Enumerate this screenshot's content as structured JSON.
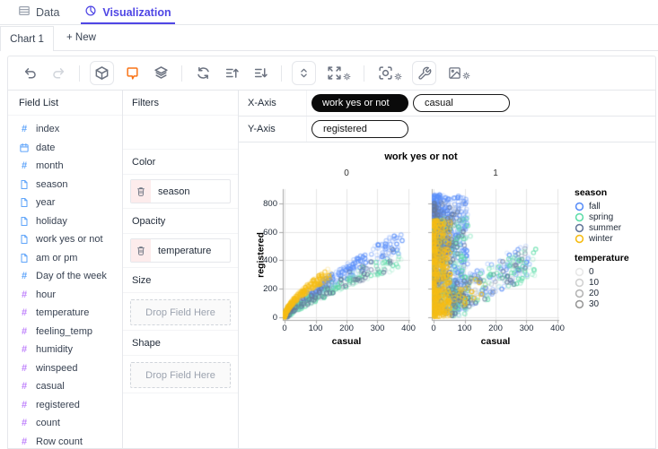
{
  "tabs": {
    "data": {
      "label": "Data"
    },
    "visualization": {
      "label": "Visualization"
    }
  },
  "chart_tabs": {
    "active": "Chart 1",
    "new_label": "+ New"
  },
  "toolbar": {
    "items": [
      {
        "icon": "undo"
      },
      {
        "icon": "redo",
        "disabled": true
      },
      {
        "divider": true
      },
      {
        "icon": "cube",
        "boxed": true
      },
      {
        "icon": "annotation",
        "accent": true
      },
      {
        "icon": "layers"
      },
      {
        "divider": true
      },
      {
        "icon": "refresh"
      },
      {
        "icon": "sort-ascending"
      },
      {
        "icon": "sort-descending"
      },
      {
        "divider": true
      },
      {
        "icon": "updown",
        "boxed": true
      },
      {
        "icon": "resize",
        "gear": true
      },
      {
        "divider": true
      },
      {
        "icon": "scan",
        "gear": true
      },
      {
        "icon": "wrench",
        "boxed": true
      },
      {
        "icon": "export-image",
        "gear": true
      }
    ]
  },
  "field_list": {
    "title": "Field List",
    "fields": [
      {
        "name": "index",
        "icon": "hash",
        "kind": "dimension"
      },
      {
        "name": "date",
        "icon": "calendar",
        "kind": "dimension"
      },
      {
        "name": "month",
        "icon": "hash",
        "kind": "dimension"
      },
      {
        "name": "season",
        "icon": "text",
        "kind": "dimension"
      },
      {
        "name": "year",
        "icon": "text",
        "kind": "dimension"
      },
      {
        "name": "holiday",
        "icon": "text",
        "kind": "dimension"
      },
      {
        "name": "work yes or not",
        "icon": "text",
        "kind": "dimension"
      },
      {
        "name": "am or pm",
        "icon": "text",
        "kind": "dimension"
      },
      {
        "name": "Day of the week",
        "icon": "hash",
        "kind": "dimension"
      },
      {
        "name": "hour",
        "icon": "hash",
        "kind": "measure"
      },
      {
        "name": "temperature",
        "icon": "hash",
        "kind": "measure"
      },
      {
        "name": "feeling_temp",
        "icon": "hash",
        "kind": "measure"
      },
      {
        "name": "humidity",
        "icon": "hash",
        "kind": "measure"
      },
      {
        "name": "winspeed",
        "icon": "hash",
        "kind": "measure"
      },
      {
        "name": "casual",
        "icon": "hash",
        "kind": "measure"
      },
      {
        "name": "registered",
        "icon": "hash",
        "kind": "measure"
      },
      {
        "name": "count",
        "icon": "hash",
        "kind": "measure"
      },
      {
        "name": "Row count",
        "icon": "hash",
        "kind": "measure"
      }
    ]
  },
  "encodings": {
    "filters": {
      "label": "Filters"
    },
    "color": {
      "label": "Color",
      "field": "season"
    },
    "opacity": {
      "label": "Opacity",
      "field": "temperature"
    },
    "size": {
      "label": "Size",
      "placeholder": "Drop Field Here"
    },
    "shape": {
      "label": "Shape",
      "placeholder": "Drop Field Here"
    }
  },
  "axes": {
    "x_label": "X-Axis",
    "y_label": "Y-Axis",
    "x_pills": [
      {
        "text": "work yes or not",
        "style": "dark"
      },
      {
        "text": "casual",
        "style": "outline"
      }
    ],
    "y_pills": [
      {
        "text": "registered",
        "style": "outline"
      }
    ]
  },
  "chart_data": {
    "type": "scatter",
    "title": "work yes or not",
    "facet_field": "work yes or not",
    "xlabel": "casual",
    "ylabel": "registered",
    "x_ticks": [
      0,
      100,
      200,
      300,
      400
    ],
    "y_ticks": [
      0,
      200,
      400,
      600,
      800
    ],
    "x_domain": [
      0,
      420
    ],
    "y_domain": [
      0,
      880
    ],
    "grid": true,
    "legend_position": "right",
    "legend": {
      "season": {
        "title": "season",
        "items": [
          {
            "label": "fall",
            "color": "#5B8FF9"
          },
          {
            "label": "spring",
            "color": "#61DDAA"
          },
          {
            "label": "summer",
            "color": "#65789B"
          },
          {
            "label": "winter",
            "color": "#F6BD16"
          }
        ]
      },
      "temperature": {
        "title": "temperature",
        "items": [
          {
            "label": "0",
            "opacity": 0.14
          },
          {
            "label": "10",
            "opacity": 0.28
          },
          {
            "label": "20",
            "opacity": 0.45
          },
          {
            "label": "30",
            "opacity": 0.62
          }
        ]
      }
    },
    "generator": {
      "seed": 7,
      "point_radius": 2.2,
      "facets": [
        {
          "label": "0",
          "groups": [
            {
              "season": "fall",
              "color": "#5B8FF9",
              "n": 330,
              "model": "fan",
              "cMax": 380,
              "cPow": 2.0,
              "slope": 4.6,
              "curve": 0.8,
              "noise": 170
            },
            {
              "season": "spring",
              "color": "#61DDAA",
              "n": 210,
              "model": "fan",
              "cMax": 380,
              "cPow": 1.8,
              "slope": 3.6,
              "curve": 0.8,
              "noise": 140
            },
            {
              "season": "summer",
              "color": "#65789B",
              "n": 140,
              "model": "fan",
              "cMax": 350,
              "cPow": 2.0,
              "slope": 4.2,
              "curve": 0.78,
              "noise": 150
            },
            {
              "season": "winter",
              "color": "#F6BD16",
              "n": 330,
              "model": "fan",
              "cMax": 150,
              "cPow": 2.4,
              "slope": 14,
              "curve": 0.62,
              "noise": 90
            }
          ]
        },
        {
          "label": "1",
          "groups": [
            {
              "season": "fall",
              "color": "#5B8FF9",
              "n": 780,
              "model": "band",
              "cMax": 110,
              "cPow": 2.2,
              "rMin": 15,
              "rMax": 860,
              "rPow": 0.75
            },
            {
              "season": "fall",
              "color": "#5B8FF9",
              "n": 150,
              "model": "tail",
              "c0": 60,
              "cMax": 310,
              "slope": 1.15,
              "r0": 60,
              "noise": 240
            },
            {
              "season": "spring",
              "color": "#61DDAA",
              "n": 280,
              "model": "band",
              "cMax": 120,
              "cPow": 2.0,
              "rMin": 10,
              "rMax": 700,
              "rPow": 0.9
            },
            {
              "season": "spring",
              "color": "#61DDAA",
              "n": 120,
              "model": "tail",
              "c0": 60,
              "cMax": 330,
              "slope": 1.1,
              "r0": 40,
              "noise": 220
            },
            {
              "season": "summer",
              "color": "#65789B",
              "n": 280,
              "model": "band",
              "cMax": 100,
              "cPow": 2.2,
              "rMin": 10,
              "rMax": 820,
              "rPow": 0.8
            },
            {
              "season": "summer",
              "color": "#65789B",
              "n": 80,
              "model": "tail",
              "c0": 60,
              "cMax": 300,
              "slope": 1.1,
              "r0": 50,
              "noise": 220
            },
            {
              "season": "winter",
              "color": "#F6BD16",
              "n": 560,
              "model": "band",
              "cMax": 55,
              "cPow": 2.4,
              "rMin": 5,
              "rMax": 680,
              "rPow": 1.15
            },
            {
              "season": "winter",
              "color": "#F6BD16",
              "n": 50,
              "model": "tail",
              "c0": 25,
              "cMax": 170,
              "slope": 1.3,
              "r0": 30,
              "noise": 160
            }
          ]
        }
      ]
    }
  }
}
